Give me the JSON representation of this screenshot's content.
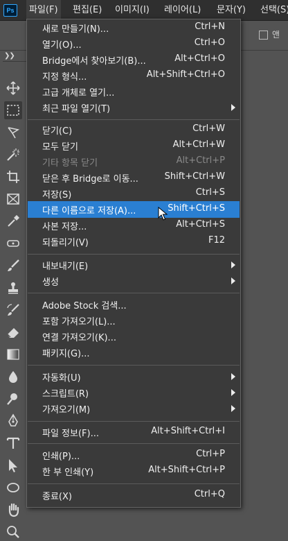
{
  "app": {
    "logo": "Ps"
  },
  "menubar": {
    "items": [
      {
        "label": "파일(F)"
      },
      {
        "label": "편집(E)"
      },
      {
        "label": "이미지(I)"
      },
      {
        "label": "레이어(L)"
      },
      {
        "label": "문자(Y)"
      },
      {
        "label": "선택(S)"
      }
    ]
  },
  "options_bar": {
    "partial_label": "앤"
  },
  "tools": [
    {
      "icon": "move-icon"
    },
    {
      "icon": "rectangular-marquee-icon",
      "selected": true
    },
    {
      "icon": "lasso-icon"
    },
    {
      "icon": "magic-wand-icon"
    },
    {
      "icon": "crop-icon"
    },
    {
      "icon": "frame-icon"
    },
    {
      "icon": "eyedropper-icon"
    },
    {
      "icon": "healing-brush-icon"
    },
    {
      "icon": "brush-icon"
    },
    {
      "icon": "clone-stamp-icon"
    },
    {
      "icon": "history-brush-icon"
    },
    {
      "icon": "eraser-icon"
    },
    {
      "icon": "gradient-icon"
    },
    {
      "icon": "blur-icon"
    },
    {
      "icon": "dodge-icon"
    },
    {
      "icon": "pen-icon"
    },
    {
      "icon": "type-icon"
    },
    {
      "icon": "path-selection-icon"
    },
    {
      "icon": "ellipse-icon"
    },
    {
      "icon": "hand-icon"
    },
    {
      "icon": "zoom-icon"
    }
  ],
  "file_menu": {
    "items": [
      {
        "label": "새로 만들기(N)...",
        "shortcut": "Ctrl+N"
      },
      {
        "label": "열기(O)...",
        "shortcut": "Ctrl+O"
      },
      {
        "label": "Bridge에서 찾아보기(B)...",
        "shortcut": "Alt+Ctrl+O"
      },
      {
        "label": "지정 형식...",
        "shortcut": "Alt+Shift+Ctrl+O"
      },
      {
        "label": "고급 개체로 열기...",
        "shortcut": ""
      },
      {
        "label": "최근 파일 열기(T)",
        "shortcut": "",
        "submenu": true
      },
      {
        "separator": true
      },
      {
        "label": "닫기(C)",
        "shortcut": "Ctrl+W"
      },
      {
        "label": "모두 닫기",
        "shortcut": "Alt+Ctrl+W"
      },
      {
        "label": "기타 항목 닫기",
        "shortcut": "Alt+Ctrl+P",
        "disabled": true
      },
      {
        "label": "닫은 후 Bridge로 이동...",
        "shortcut": "Shift+Ctrl+W"
      },
      {
        "label": "저장(S)",
        "shortcut": "Ctrl+S"
      },
      {
        "label": "다른 이름으로 저장(A)...",
        "shortcut": "Shift+Ctrl+S",
        "highlighted": true
      },
      {
        "label": "사본 저장...",
        "shortcut": "Alt+Ctrl+S"
      },
      {
        "label": "되돌리기(V)",
        "shortcut": "F12"
      },
      {
        "separator": true
      },
      {
        "label": "내보내기(E)",
        "shortcut": "",
        "submenu": true
      },
      {
        "label": "생성",
        "shortcut": "",
        "submenu": true
      },
      {
        "separator": true
      },
      {
        "label": "Adobe Stock 검색...",
        "shortcut": ""
      },
      {
        "label": "포함 가져오기(L)...",
        "shortcut": ""
      },
      {
        "label": "연결 가져오기(K)...",
        "shortcut": ""
      },
      {
        "label": "패키지(G)...",
        "shortcut": ""
      },
      {
        "separator": true
      },
      {
        "label": "자동화(U)",
        "shortcut": "",
        "submenu": true
      },
      {
        "label": "스크립트(R)",
        "shortcut": "",
        "submenu": true
      },
      {
        "label": "가져오기(M)",
        "shortcut": "",
        "submenu": true
      },
      {
        "separator": true
      },
      {
        "label": "파일 정보(F)...",
        "shortcut": "Alt+Shift+Ctrl+I"
      },
      {
        "separator": true
      },
      {
        "label": "인쇄(P)...",
        "shortcut": "Ctrl+P"
      },
      {
        "label": "한 부 인쇄(Y)",
        "shortcut": "Alt+Shift+Ctrl+P"
      },
      {
        "separator": true
      },
      {
        "label": "종료(X)",
        "shortcut": "Ctrl+Q"
      }
    ]
  },
  "colors": {
    "menubar_bg": "#2f2f2f",
    "menu_bg": "#3a3a3a",
    "highlight": "#2a7fd2",
    "workspace": "#535353",
    "ps_blue": "#31a8ff"
  }
}
